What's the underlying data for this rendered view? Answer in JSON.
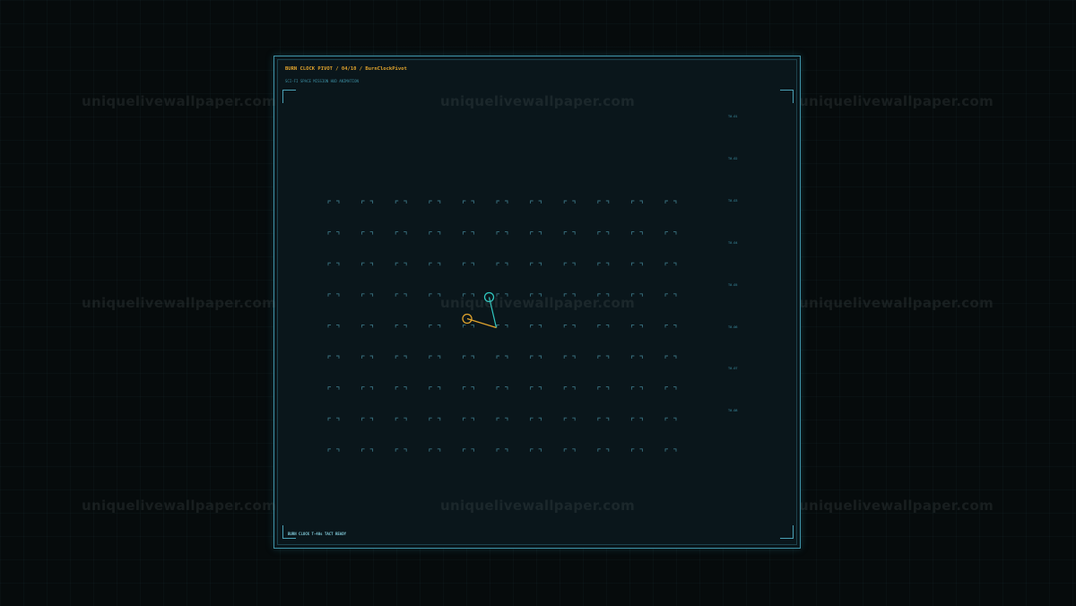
{
  "watermark": {
    "text": "uniquelivewallpaper.com"
  },
  "panel": {
    "title_prefix": "BURN CLOCK PIVOT",
    "title_sep": "/",
    "title_index": "04/10",
    "title_name": "BurnClockPivot",
    "subtitle": "SCI-FI SPACE MISSION HUD ANIMATION",
    "status": "BURN CLOCK T-40s TACT READY"
  },
  "ticks": [
    "T0.01",
    "T0.02",
    "T0.03",
    "T0.04",
    "T0.05",
    "T0.06",
    "T0.07",
    "T0.08"
  ],
  "grid": {
    "columns": 11,
    "rows": 9
  },
  "pivot": {
    "teal_color": "#2fc7c0",
    "amber_color": "#e0a32d",
    "bracket_color": "#3a7382",
    "panel_border": "#3f93a8"
  }
}
